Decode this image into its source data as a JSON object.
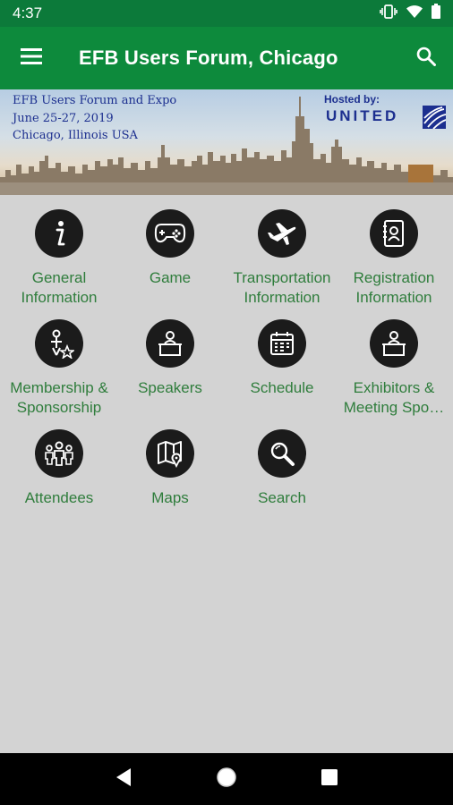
{
  "status": {
    "time": "4:37"
  },
  "app_bar": {
    "title": "EFB Users Forum, Chicago"
  },
  "banner": {
    "line1": "EFB Users Forum and Expo",
    "line2": "June 25-27, 2019",
    "line3": "Chicago, Illinois USA",
    "hosted_by": "Hosted by:",
    "logo": "UNITED"
  },
  "tiles": [
    {
      "label": "General\nInformation",
      "icon": "info-icon"
    },
    {
      "label": "Game",
      "icon": "gamepad-icon"
    },
    {
      "label": "Transportation\nInformation",
      "icon": "airplane-icon"
    },
    {
      "label": "Registration\nInformation",
      "icon": "contact-book-icon"
    },
    {
      "label": "Membership &\nSponsorship",
      "icon": "membership-icon"
    },
    {
      "label": "Speakers",
      "icon": "speaker-podium-icon"
    },
    {
      "label": "Schedule",
      "icon": "calendar-icon"
    },
    {
      "label": "Exhibitors &\nMeeting Spo…",
      "icon": "exhibitor-podium-icon"
    },
    {
      "label": "Attendees",
      "icon": "people-icon"
    },
    {
      "label": "Maps",
      "icon": "map-icon"
    },
    {
      "label": "Search",
      "icon": "search-icon"
    }
  ],
  "colors": {
    "status_bar": "#0c7a3a",
    "app_bar": "#0d8a3c",
    "label": "#2f7d3c",
    "background": "#d3d3d3"
  }
}
